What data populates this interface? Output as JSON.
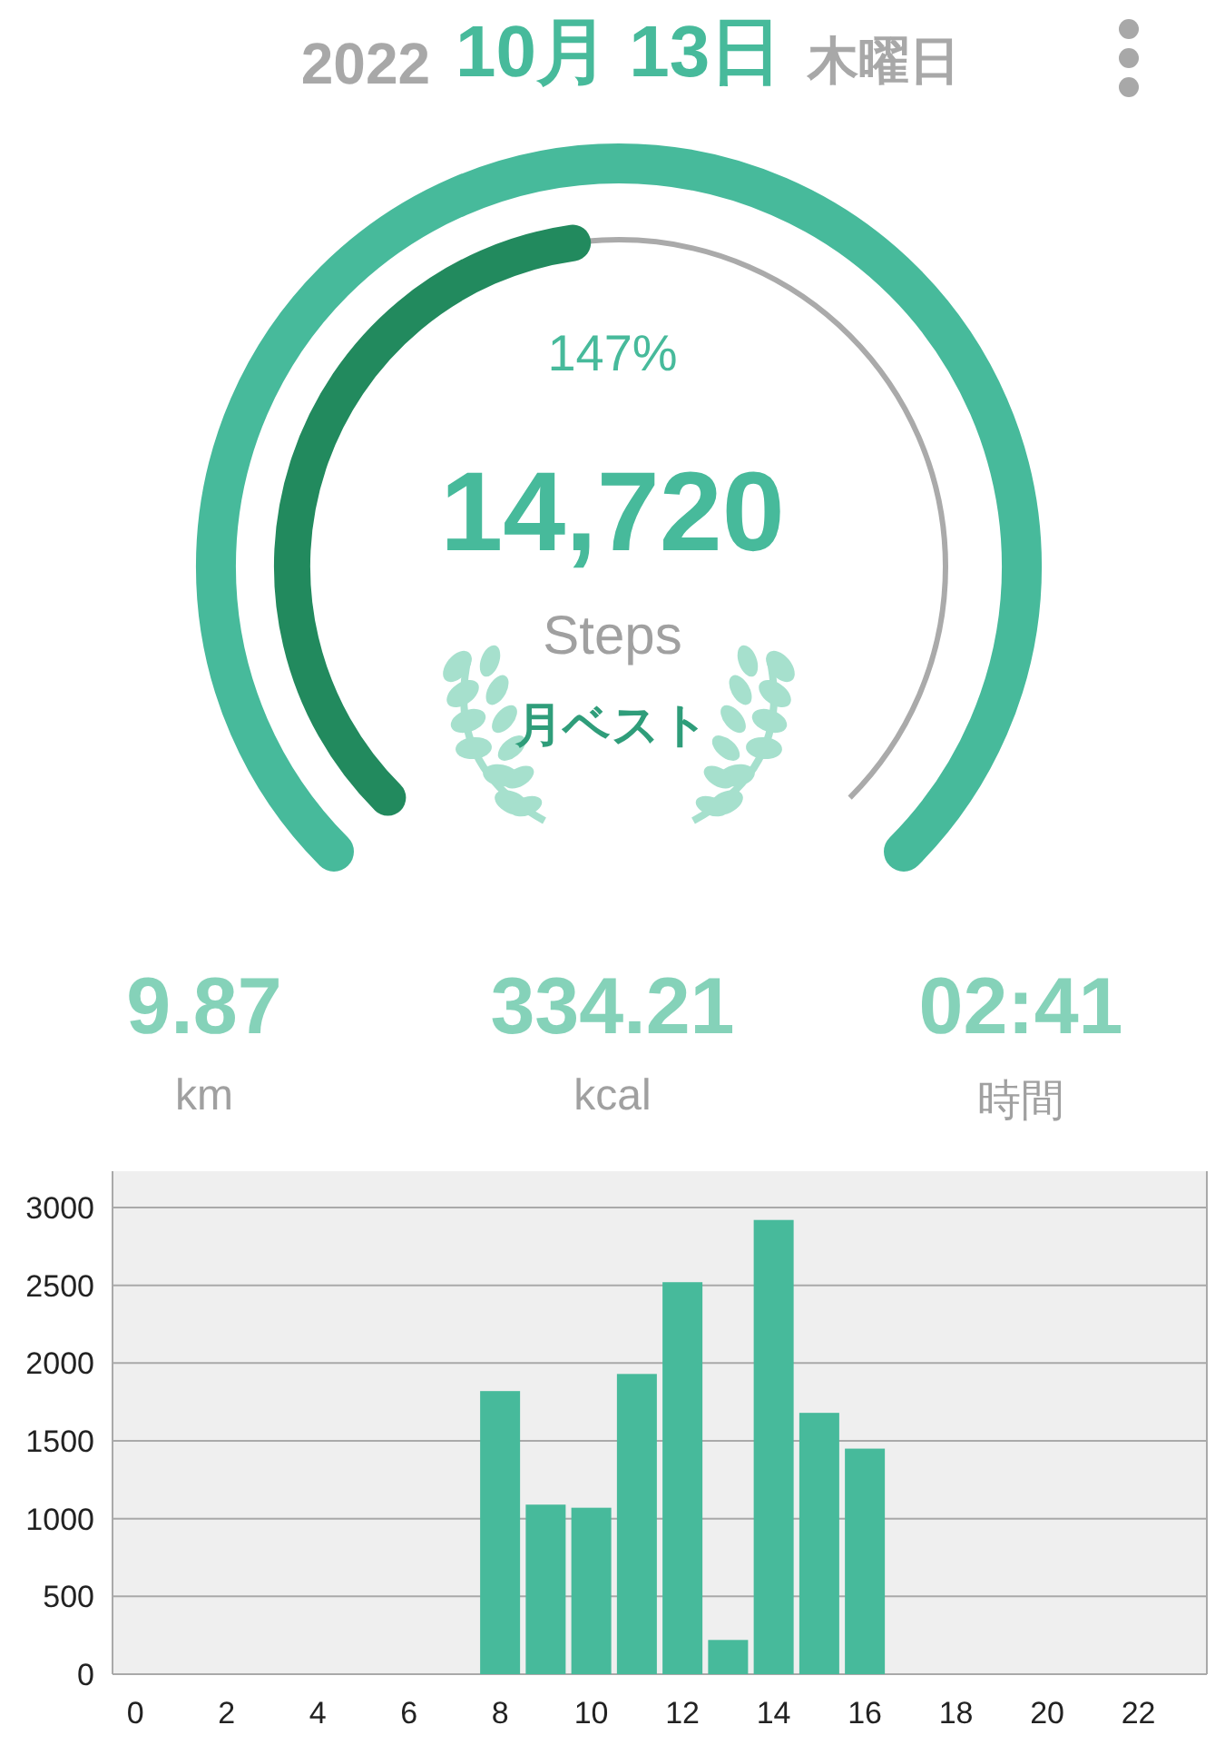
{
  "header": {
    "year": "2022",
    "month_day": "10月 13日",
    "weekday": "木曜日"
  },
  "gauge": {
    "percent": "147%",
    "steps": "14,720",
    "unit": "Steps",
    "award": "月ベスト"
  },
  "stats": [
    {
      "value": "9.87",
      "label": "km"
    },
    {
      "value": "334.21",
      "label": "kcal"
    },
    {
      "value": "02:41",
      "label": "時間"
    }
  ],
  "chart": {
    "chart_data": {
      "type": "bar",
      "x": [
        0,
        1,
        2,
        3,
        4,
        5,
        6,
        7,
        8,
        9,
        10,
        11,
        12,
        13,
        14,
        15,
        16,
        17,
        18,
        19,
        20,
        21,
        22,
        23
      ],
      "xlim": [
        -0.5,
        23.5
      ],
      "grid": true,
      "values": [
        0,
        0,
        0,
        0,
        0,
        0,
        0,
        0,
        1820,
        1090,
        1070,
        1930,
        2520,
        220,
        2920,
        1680,
        1450,
        0,
        0,
        0,
        0,
        0,
        0,
        0
      ],
      "ylim": [
        0,
        3000
      ],
      "yticks": [
        0,
        500,
        1000,
        1500,
        2000,
        2500,
        3000
      ],
      "xticks": [
        0,
        2,
        4,
        6,
        8,
        10,
        12,
        14,
        16,
        18,
        20,
        22
      ]
    }
  }
}
